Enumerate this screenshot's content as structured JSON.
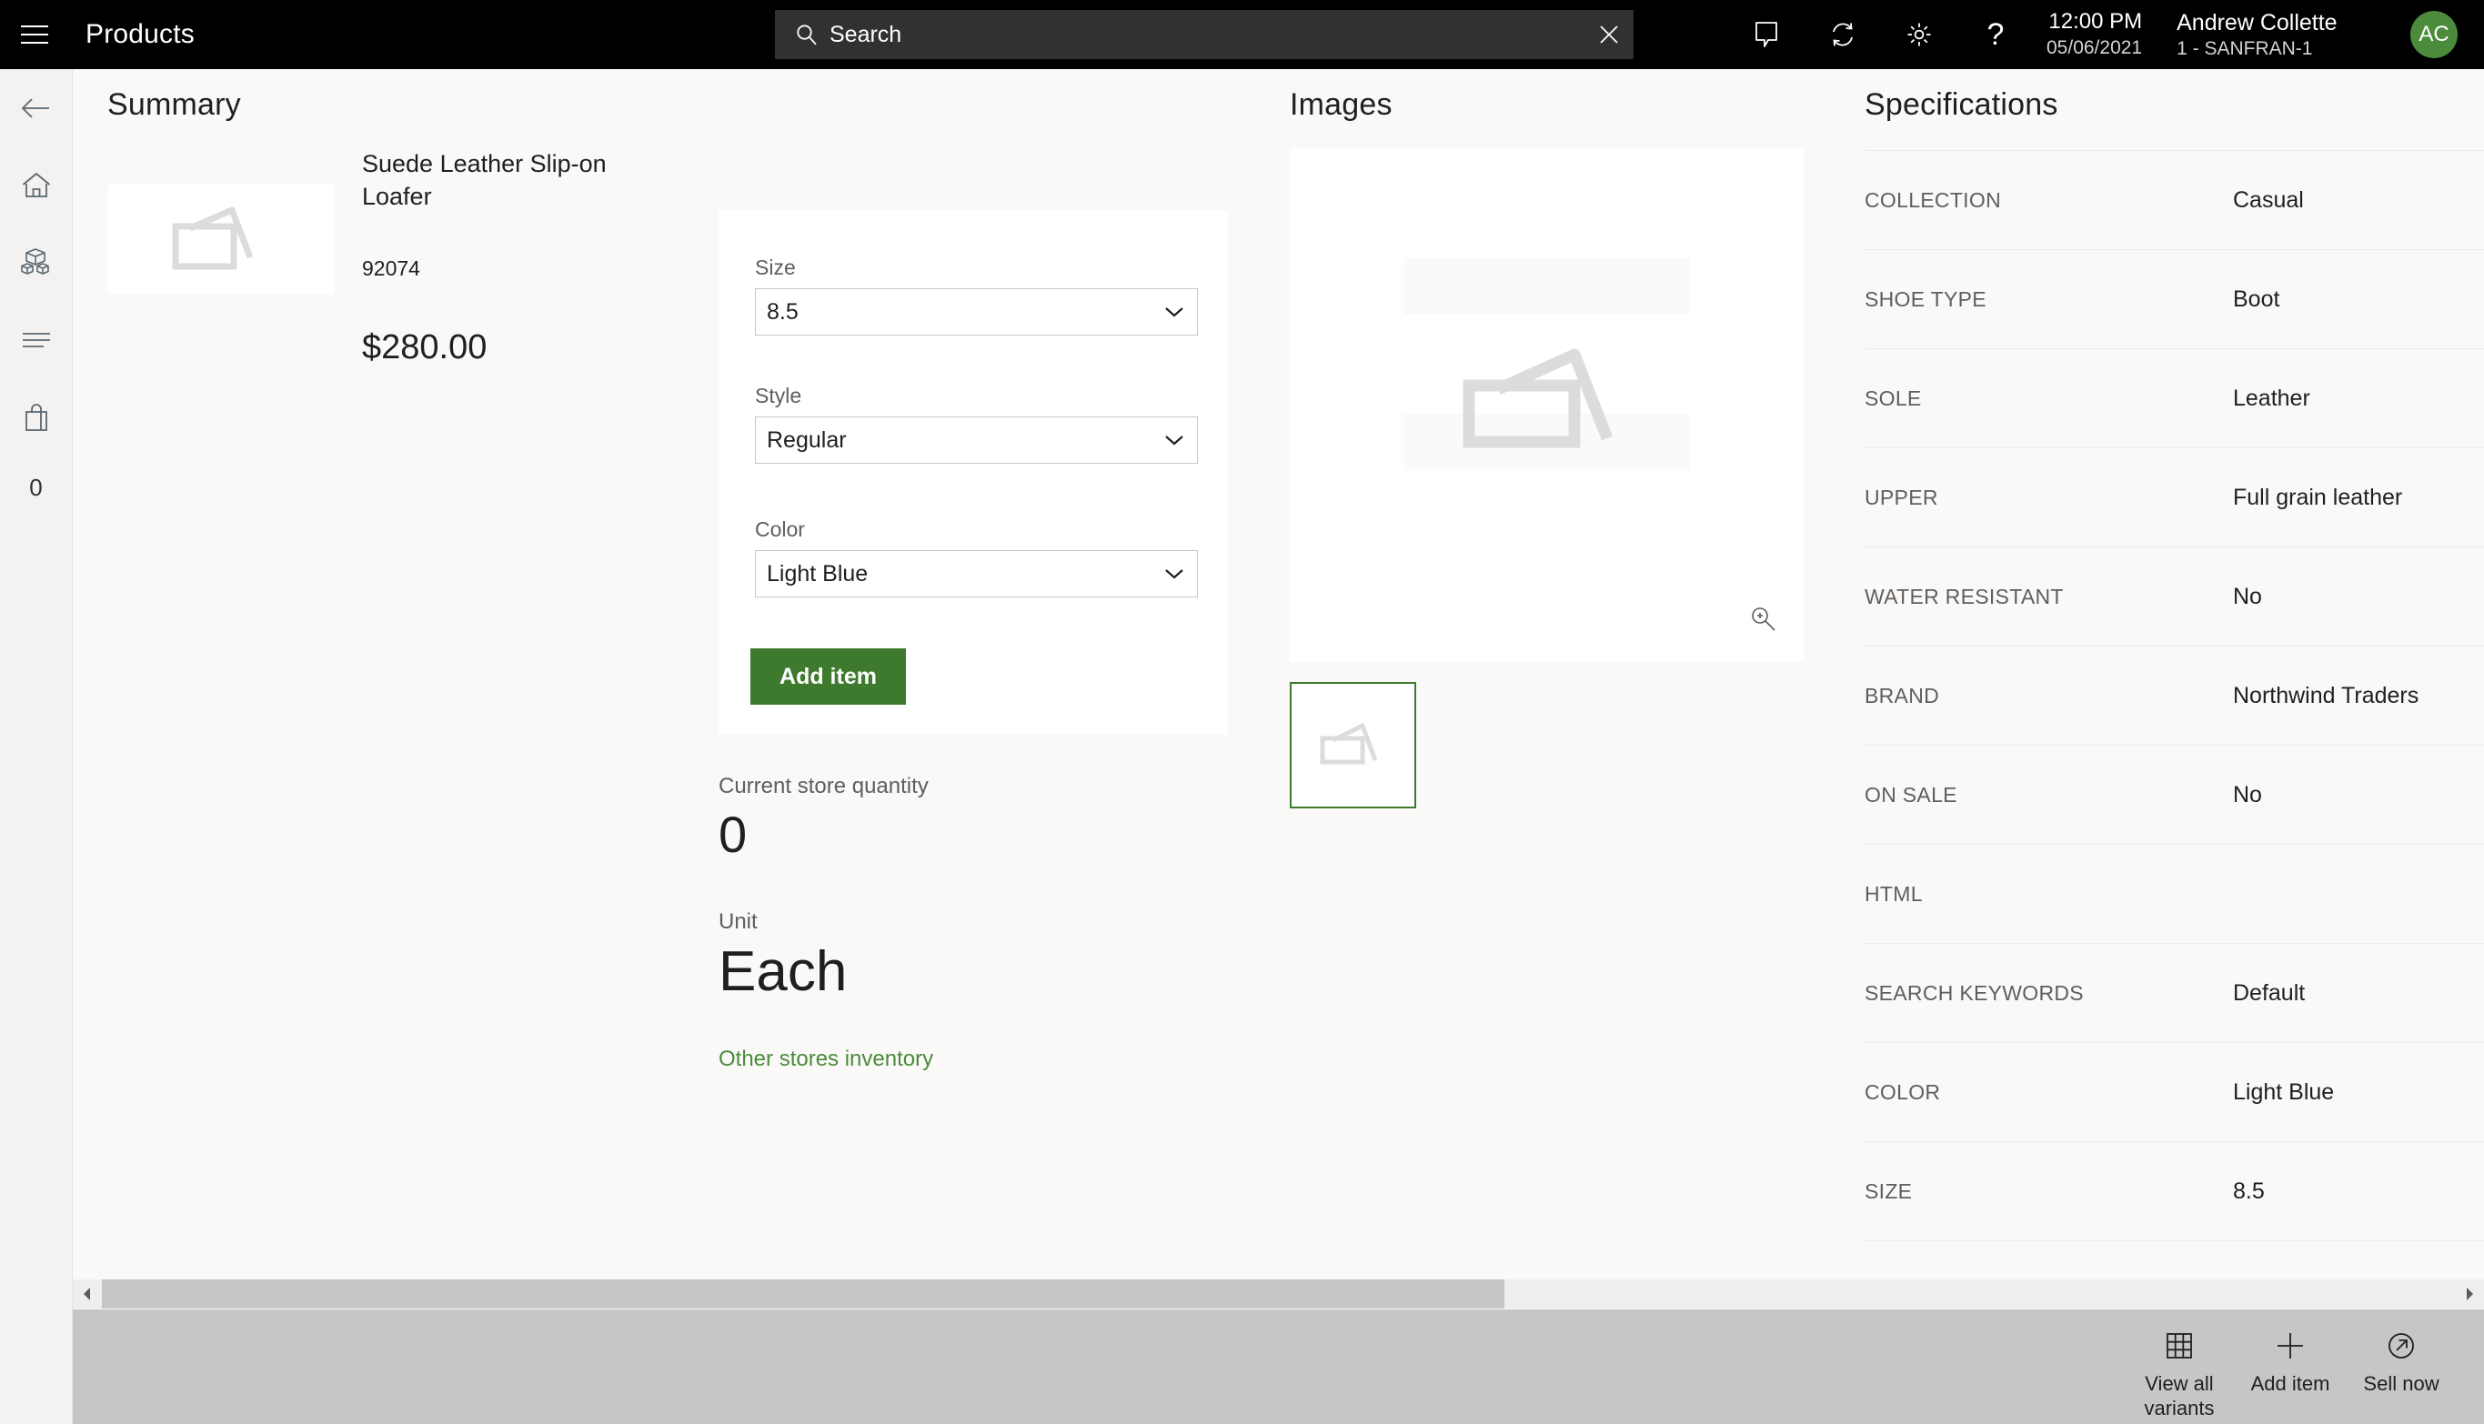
{
  "topbar": {
    "menu_icon": "hamburger-icon",
    "app_title": "Products",
    "search": {
      "icon": "search-icon",
      "placeholder": "Search",
      "value": "",
      "clear_icon": "close-icon"
    },
    "icons": [
      {
        "name": "chat-icon",
        "glyph": "chat"
      },
      {
        "name": "sync-icon",
        "glyph": "sync"
      },
      {
        "name": "gear-icon",
        "glyph": "gear"
      },
      {
        "name": "help-icon",
        "glyph": "?"
      }
    ],
    "clock": {
      "time": "12:00 PM",
      "date": "05/06/2021"
    },
    "user": {
      "name": "Andrew Collette",
      "store": "1 - SANFRAN-1",
      "initials": "AC"
    },
    "accent_green": "#4b8b3b"
  },
  "rail": {
    "items": [
      {
        "name": "back-button",
        "icon": "back-arrow-icon",
        "label": ""
      },
      {
        "name": "home-button",
        "icon": "home-icon",
        "label": ""
      },
      {
        "name": "products-button",
        "icon": "boxes-icon",
        "label": ""
      },
      {
        "name": "list-button",
        "icon": "list-lines-icon",
        "label": ""
      },
      {
        "name": "cart-button",
        "icon": "shopping-bag-icon",
        "label": ""
      },
      {
        "name": "cart-count",
        "icon": "",
        "label": "0"
      }
    ]
  },
  "summary": {
    "title": "Summary",
    "product_name": "Suede Leather Slip-on Loafer",
    "sku": "92074",
    "price": "$280.00",
    "thumbnail_icon": "image-placeholder-icon"
  },
  "variant_form": {
    "fields": [
      {
        "name": "size",
        "label": "Size",
        "value": "8.5",
        "options": [
          "8.5"
        ]
      },
      {
        "name": "style",
        "label": "Style",
        "value": "Regular",
        "options": [
          "Regular"
        ]
      },
      {
        "name": "color",
        "label": "Color",
        "value": "Light Blue",
        "options": [
          "Light Blue"
        ]
      }
    ],
    "add_item_label": "Add item",
    "button_color": "#3e7a2e"
  },
  "inventory": {
    "quantity_label": "Current store quantity",
    "quantity_value": "0",
    "unit_label": "Unit",
    "unit_value": "Each",
    "other_stores_link": "Other stores inventory"
  },
  "images": {
    "title": "Images",
    "main_placeholder_icon": "image-placeholder-icon",
    "zoom_icon": "zoom-in-icon",
    "thumbnails": [
      {
        "name": "thumbnail-1",
        "icon": "image-placeholder-icon",
        "selected": true
      }
    ]
  },
  "specifications": {
    "title": "Specifications",
    "rows": [
      {
        "key": "COLLECTION",
        "value": "Casual"
      },
      {
        "key": "SHOE TYPE",
        "value": "Boot"
      },
      {
        "key": "SOLE",
        "value": "Leather"
      },
      {
        "key": "UPPER",
        "value": "Full grain leather"
      },
      {
        "key": "WATER RESISTANT",
        "value": "No"
      },
      {
        "key": "BRAND",
        "value": "Northwind Traders"
      },
      {
        "key": "ON SALE",
        "value": "No"
      },
      {
        "key": "HTML",
        "value": ""
      },
      {
        "key": "SEARCH KEYWORDS",
        "value": "Default"
      },
      {
        "key": "COLOR",
        "value": "Light Blue"
      },
      {
        "key": "SIZE",
        "value": "8.5"
      }
    ]
  },
  "scrollbar": {
    "left_arrow_icon": "chevron-left-icon",
    "right_arrow_icon": "chevron-right-icon"
  },
  "commandbar": {
    "items": [
      {
        "name": "view-all-variants-button",
        "icon": "grid-icon",
        "label": "View all variants"
      },
      {
        "name": "add-item-button",
        "icon": "plus-icon",
        "label": "Add item"
      },
      {
        "name": "sell-now-button",
        "icon": "arrow-circle-icon",
        "label": "Sell now"
      }
    ]
  }
}
